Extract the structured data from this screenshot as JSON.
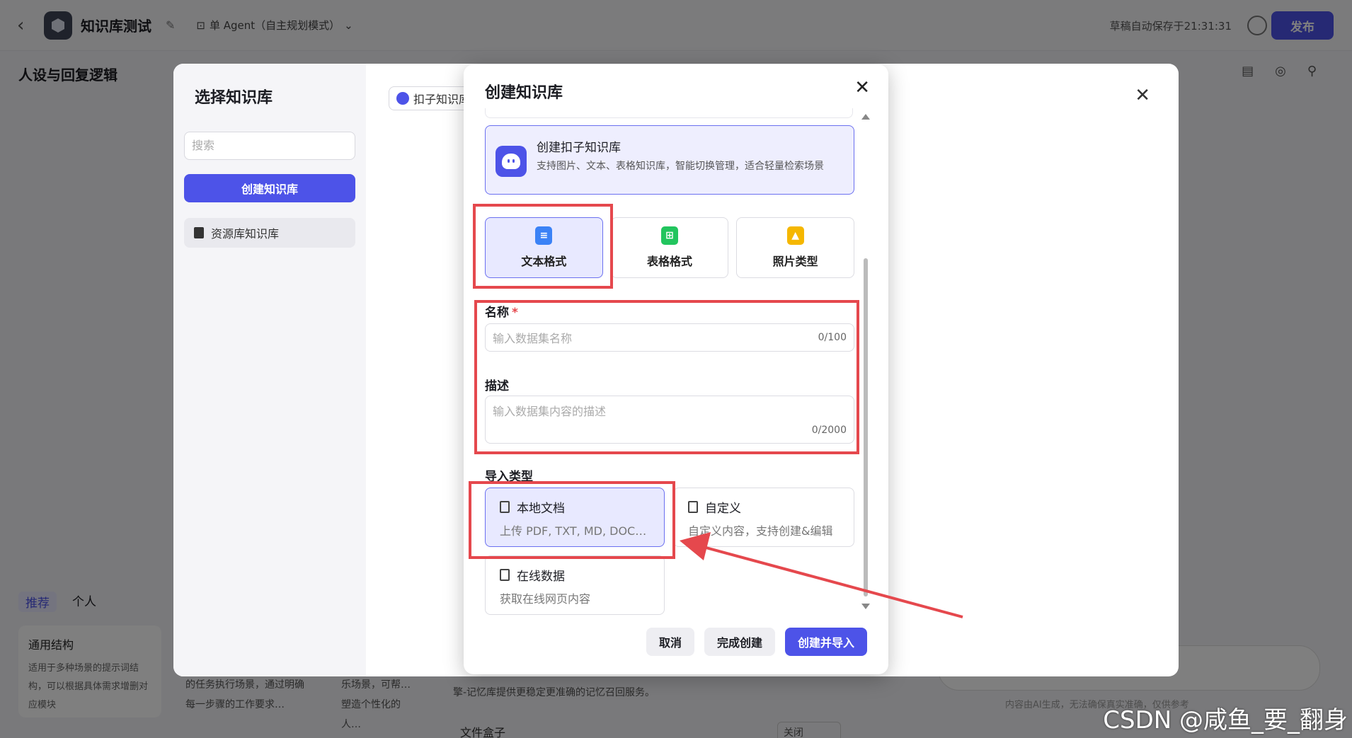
{
  "topbar": {
    "app_title": "知识库测试",
    "agent_mode": "单 Agent（自主规划模式）",
    "autosave": "草稿自动保存于21:31:31",
    "publish": "发布"
  },
  "persona_title": "人设与回复逻辑",
  "background": {
    "tabs": [
      "推荐",
      "个人"
    ],
    "card_title": "通用结构",
    "card_desc": "适用于多种场景的提示词结构，可以根据具体需求增删对应模块",
    "snippet_1": "的任务执行场景，通过明确每一步骤的工作要求…",
    "snippet_2": "乐场景，可帮…塑造个性化的人…",
    "snippet_3": "擎-记忆库提供更稳定更准确的记忆召回服务。",
    "file_box": "文件盒子",
    "close_select": "关闭",
    "ai_note": "内容由AI生成，无法确保真实准确，仅供参考"
  },
  "select_kb": {
    "title": "选择知识库",
    "search_placeholder": "搜索",
    "create_button": "创建知识库",
    "resource_item": "资源库知识库",
    "tab_chip": "扣子知识库"
  },
  "create_kb": {
    "title": "创建知识库",
    "coze_card": {
      "title": "创建扣子知识库",
      "desc": "支持图片、文本、表格知识库，智能切换管理，适合轻量检索场景"
    },
    "formats": [
      "文本格式",
      "表格格式",
      "照片类型"
    ],
    "name_label": "名称",
    "name_required": "*",
    "name_placeholder": "输入数据集名称",
    "name_counter": "0/100",
    "desc_label": "描述",
    "desc_placeholder": "输入数据集内容的描述",
    "desc_counter": "0/2000",
    "import_label": "导入类型",
    "imports": [
      {
        "title": "本地文档",
        "desc": "上传 PDF, TXT, MD, DOC, DOCX 格式的本地文件"
      },
      {
        "title": "自定义",
        "desc": "自定义内容，支持创建&编辑"
      },
      {
        "title": "在线数据",
        "desc": "获取在线网页内容"
      }
    ],
    "cancel": "取消",
    "finish": "完成创建",
    "create_import": "创建并导入"
  },
  "watermark": "CSDN @咸鱼_要_翻身",
  "colors": {
    "accent": "#4d53e8",
    "annotation_red": "#e5484d"
  }
}
